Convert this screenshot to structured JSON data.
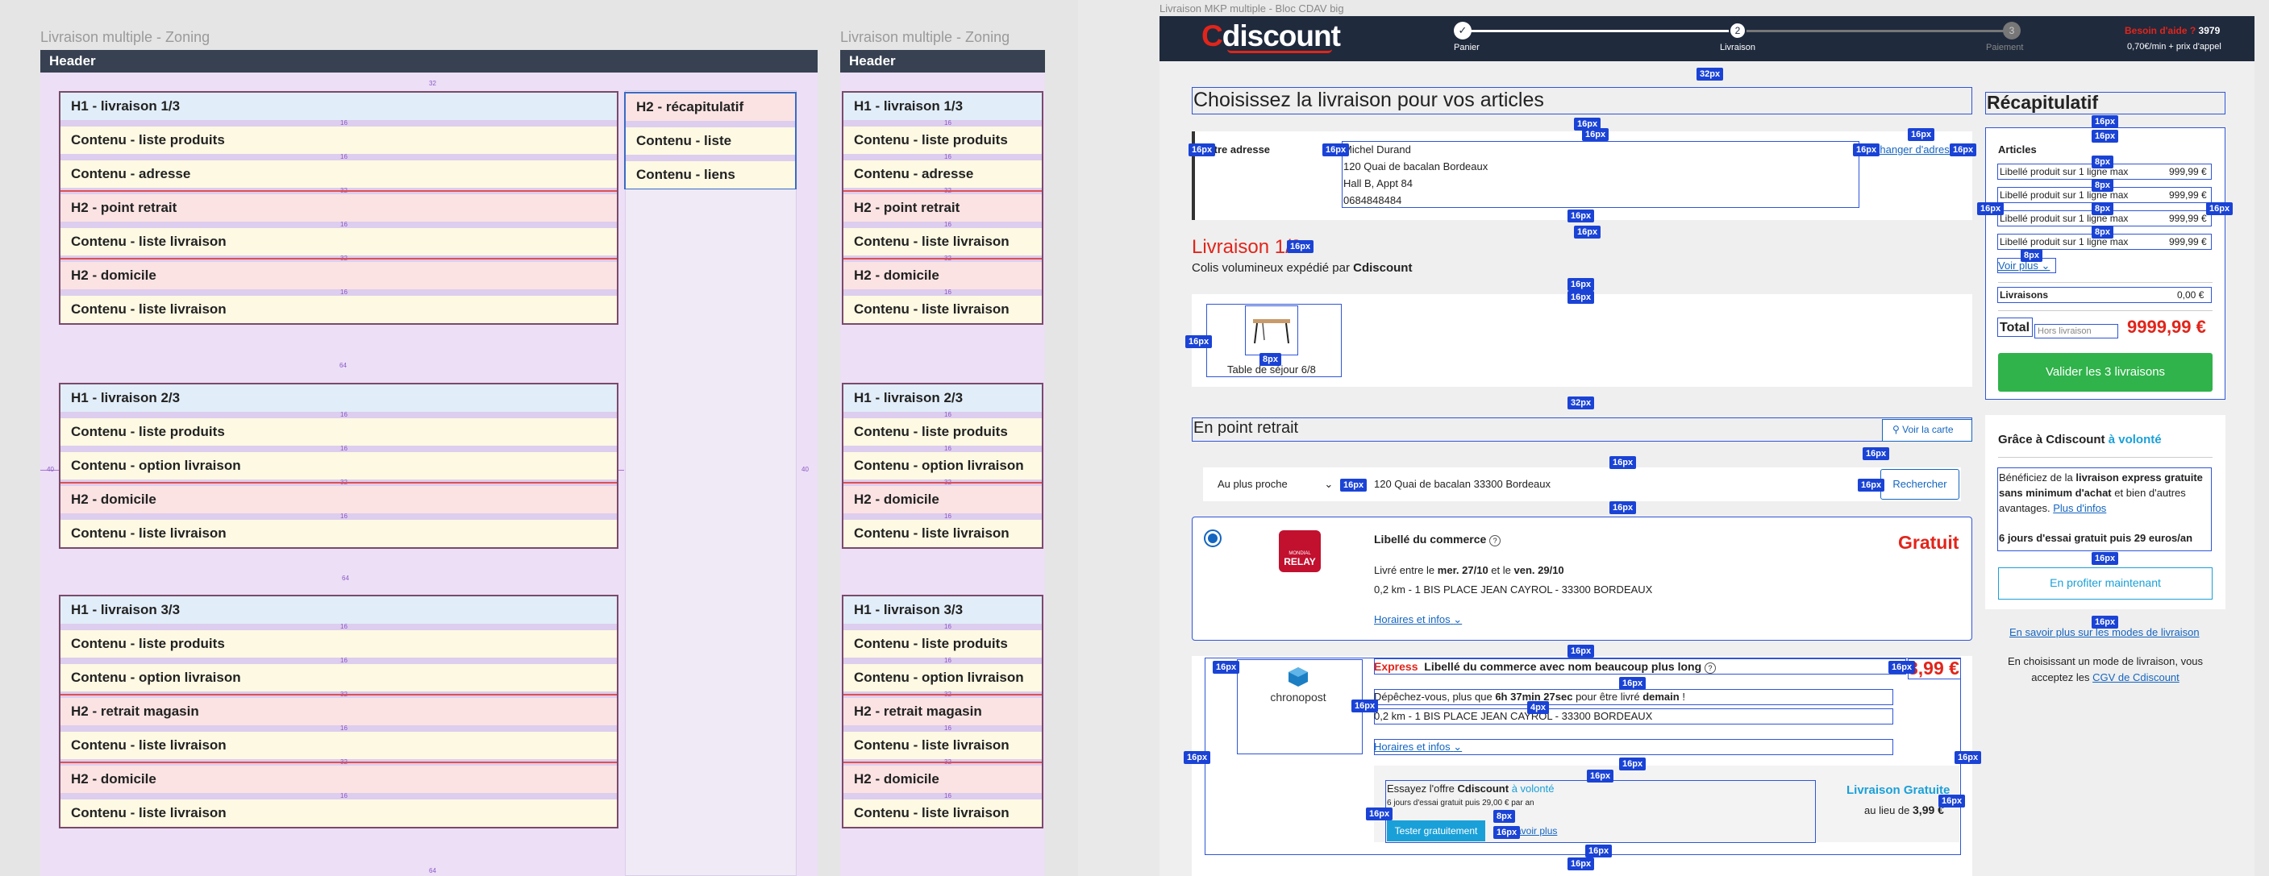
{
  "left_frame": {
    "title": "Livraison multiple - Zoning",
    "header": "Header",
    "groups": [
      {
        "rows": [
          {
            "kind": "h1",
            "label": "H1 - livraison 1/3"
          },
          {
            "kind": "ct",
            "label": "Contenu - liste produits"
          },
          {
            "kind": "ct",
            "label": "Contenu - adresse"
          },
          {
            "kind": "h2",
            "label": "H2 - point retrait"
          },
          {
            "kind": "ct",
            "label": "Contenu - liste livraison"
          },
          {
            "kind": "h2",
            "label": "H2 - domicile"
          },
          {
            "kind": "ct",
            "label": "Contenu - liste livraison"
          }
        ]
      },
      {
        "rows": [
          {
            "kind": "h1",
            "label": "H1 - livraison 2/3"
          },
          {
            "kind": "ct",
            "label": "Contenu - liste produits"
          },
          {
            "kind": "ct",
            "label": "Contenu - option livraison"
          },
          {
            "kind": "h2",
            "label": "H2 - domicile"
          },
          {
            "kind": "ct",
            "label": "Contenu - liste livraison"
          }
        ]
      },
      {
        "rows": [
          {
            "kind": "h1",
            "label": "H1 - livraison 3/3"
          },
          {
            "kind": "ct",
            "label": "Contenu - liste produits"
          },
          {
            "kind": "ct",
            "label": "Contenu - option livraison"
          },
          {
            "kind": "h2",
            "label": "H2 - retrait magasin"
          },
          {
            "kind": "ct",
            "label": "Contenu - liste livraison"
          },
          {
            "kind": "h2",
            "label": "H2 - domicile"
          },
          {
            "kind": "ct",
            "label": "Contenu - liste livraison"
          }
        ]
      }
    ],
    "side": [
      {
        "kind": "h2",
        "label": "H2 - récapitulatif"
      },
      {
        "kind": "ct",
        "label": "Contenu - liste"
      },
      {
        "kind": "ct",
        "label": "Contenu - liens"
      }
    ],
    "spacing": {
      "s16": "16",
      "s32": "32",
      "s64": "64",
      "s40": "40"
    }
  },
  "mid_frame": {
    "title": "Livraison multiple - Zoning",
    "header": "Header"
  },
  "right_frame": {
    "title": "Livraison MKP multiple - Bloc CDAV big",
    "logo": "Cdiscount",
    "logo_first": "C",
    "logo_rest": "discount",
    "steps": [
      {
        "num": "✓",
        "label": "Panier"
      },
      {
        "num": "2",
        "label": "Livraison"
      },
      {
        "num": "3",
        "label": "Paiement"
      }
    ],
    "help": {
      "label": "Besoin d'aide ?",
      "number": "3979",
      "price": "0,70€/min + prix d'appel"
    },
    "main_title": "Choisissez la livraison pour vos articles",
    "address": {
      "label": "Votre adresse",
      "name": "Michel Durand",
      "line1": "120 Quai de bacalan Bordeaux",
      "line2": "Hall B, Appt 84",
      "phone": "0684848484",
      "change": "Changer d'adresse"
    },
    "livraison_title": "Livraison 1/3",
    "colis": "Colis volumineux expédié par",
    "colis_brand": "Cdiscount",
    "product": "Table de séjour 6/8",
    "point_retrait": "En point retrait",
    "voir_carte": "Voir la carte",
    "sort": "Au plus proche",
    "search_addr": "120 Quai de bacalan 33300 Bordeaux",
    "rechercher": "Rechercher",
    "relay": {
      "name": "Libellé du commerce",
      "logo_top": "MONDIAL",
      "logo_main": "RELAY",
      "price": "Gratuit",
      "dates_pre": "Livré entre le",
      "date1": "mer. 27/10",
      "dates_mid": "et le",
      "date2": "ven. 29/10",
      "addr": "0,2 km - 1 BIS PLACE JEAN CAYROL - 33300 BORDEAUX",
      "horaires": "Horaires et infos"
    },
    "chrono": {
      "logo": "chronopost",
      "express": "Express",
      "name": "Libellé du commerce avec nom beaucoup plus long",
      "price": "3,99 €",
      "hurry_pre": "Dépêchez-vous, plus que",
      "hurry_time": "6h 37min 27sec",
      "hurry_mid": "pour être livré",
      "hurry_day": "demain",
      "addr": "0,2 km - 1 BIS PLACE JEAN CAYROL - 33300 BORDEAUX",
      "horaires": "Horaires et infos",
      "offer_pre": "Essayez l'offre",
      "offer_brand": "Cdiscount",
      "offer_post": "à volonté",
      "offer_sub": "6 jours d'essai gratuit puis 29,00 € par an",
      "tester": "Tester gratuitement",
      "savoir": "En savoir plus",
      "liv_gratuite": "Livraison Gratuite",
      "au_lieu": "au lieu de",
      "au_lieu_price": "3,99 €"
    },
    "recap": {
      "title": "Récapitulatif",
      "articles": "Articles",
      "items": [
        {
          "label": "Libellé produit sur 1 ligne max",
          "price": "999,99 €"
        },
        {
          "label": "Libellé produit sur 1 ligne max",
          "price": "999,99 €"
        },
        {
          "label": "Libellé produit sur 1 ligne max",
          "price": "999,99 €"
        },
        {
          "label": "Libellé produit sur 1 ligne max",
          "price": "999,99 €"
        }
      ],
      "voir_plus": "Voir plus",
      "livraisons": "Livraisons",
      "liv_price": "0,00 €",
      "total": "Total",
      "hors": "Hors livraison",
      "total_price": "9999,99 €",
      "valider": "Valider les 3 livraisons"
    },
    "cdav": {
      "title_pre": "Grâce à",
      "brand": "Cdiscount",
      "title_post": "à volonté",
      "b1": "Bénéficiez de la",
      "b2": "livraison express gratuite sans minimum d'achat",
      "b3": "et bien d'autres avantages.",
      "plus": "Plus d'infos",
      "b4": "6 jours d'essai gratuit puis 29 euros/an",
      "btn": "En profiter maintenant"
    },
    "modes_link": "En savoir plus sur les modes de livraison",
    "cgv_pre": "En choisissant un mode de livraison, vous acceptez les",
    "cgv": "CGV de Cdiscount",
    "badges": {
      "b16": "16px",
      "b32": "32px",
      "b8": "8px",
      "b4": "4px"
    }
  },
  "colors": {
    "accent": "#1465c0",
    "brand_red": "#e1251b",
    "green": "#2fb34a",
    "badge": "#1a43d6",
    "header": "#374151"
  }
}
